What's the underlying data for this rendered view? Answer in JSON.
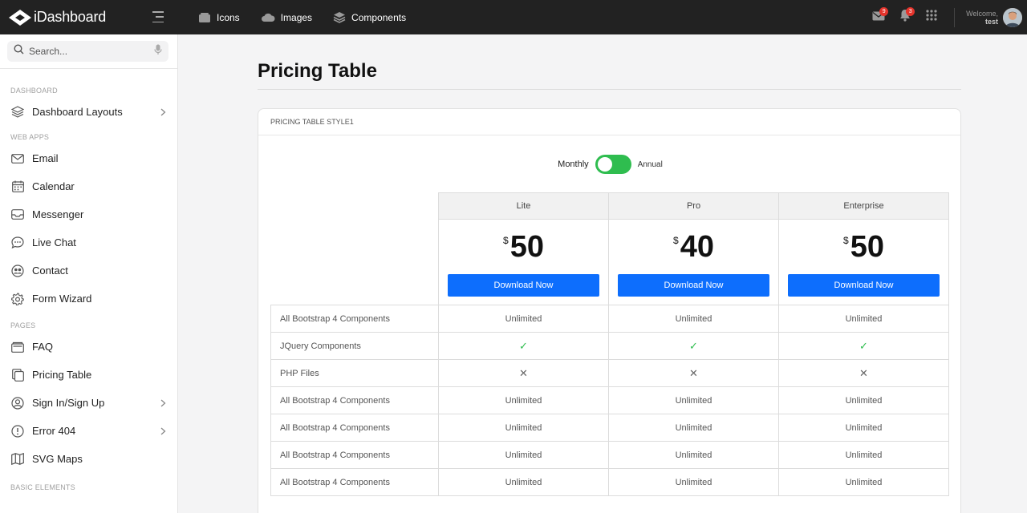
{
  "brand": {
    "name": "iDashboard"
  },
  "topnav": [
    {
      "label": "Icons",
      "icon": "layers-icon"
    },
    {
      "label": "Images",
      "icon": "cloud-icon"
    },
    {
      "label": "Components",
      "icon": "stack-icon"
    }
  ],
  "topright": {
    "mail_count": "9",
    "notif_count": "3",
    "welcome": "Welcome,",
    "user": "test"
  },
  "search": {
    "placeholder": "Search..."
  },
  "sidebar": {
    "sections": [
      {
        "label": "DASHBOARD"
      },
      {
        "label": "WEB APPS"
      },
      {
        "label": "PAGES"
      },
      {
        "label": "BASIC ELEMENTS"
      }
    ],
    "items": [
      {
        "label": "Dashboard Layouts",
        "icon": "layers-icon",
        "chevron": true
      },
      {
        "label": "Email",
        "icon": "mail-icon"
      },
      {
        "label": "Calendar",
        "icon": "calendar-icon"
      },
      {
        "label": "Messenger",
        "icon": "inbox-icon"
      },
      {
        "label": "Live Chat",
        "icon": "chat-icon"
      },
      {
        "label": "Contact",
        "icon": "contacts-icon"
      },
      {
        "label": "Form Wizard",
        "icon": "gear-icon"
      },
      {
        "label": "FAQ",
        "icon": "folder-icon"
      },
      {
        "label": "Pricing Table",
        "icon": "copy-icon"
      },
      {
        "label": "Sign In/Sign Up",
        "icon": "user-circle-icon",
        "chevron": true
      },
      {
        "label": "Error 404",
        "icon": "alert-icon",
        "chevron": true
      },
      {
        "label": "SVG Maps",
        "icon": "map-icon"
      }
    ]
  },
  "page": {
    "title": "Pricing Table",
    "card_title": "PRICING TABLE STYLE1",
    "toggle": {
      "left": "Monthly",
      "right": "Annual",
      "on": true
    }
  },
  "plans": [
    {
      "name": "Lite",
      "currency": "$",
      "price": "50",
      "button": "Download Now"
    },
    {
      "name": "Pro",
      "currency": "$",
      "price": "40",
      "button": "Download Now"
    },
    {
      "name": "Enterprise",
      "currency": "$",
      "price": "50",
      "button": "Download Now"
    }
  ],
  "features": [
    {
      "name": "All Bootstrap 4 Components",
      "values": [
        "Unlimited",
        "Unlimited",
        "Unlimited"
      ]
    },
    {
      "name": "JQuery Components",
      "values": [
        "✓",
        "✓",
        "✓"
      ]
    },
    {
      "name": "PHP Files",
      "values": [
        "✕",
        "✕",
        "✕"
      ]
    },
    {
      "name": "All Bootstrap 4 Components",
      "values": [
        "Unlimited",
        "Unlimited",
        "Unlimited"
      ]
    },
    {
      "name": "All Bootstrap 4 Components",
      "values": [
        "Unlimited",
        "Unlimited",
        "Unlimited"
      ]
    },
    {
      "name": "All Bootstrap 4 Components",
      "values": [
        "Unlimited",
        "Unlimited",
        "Unlimited"
      ]
    },
    {
      "name": "All Bootstrap 4 Components",
      "values": [
        "Unlimited",
        "Unlimited",
        "Unlimited"
      ]
    }
  ],
  "colors": {
    "accent": "#0d6efd",
    "toggle": "#2fbd4f",
    "topbar": "#222222",
    "badge": "#e5342c"
  }
}
